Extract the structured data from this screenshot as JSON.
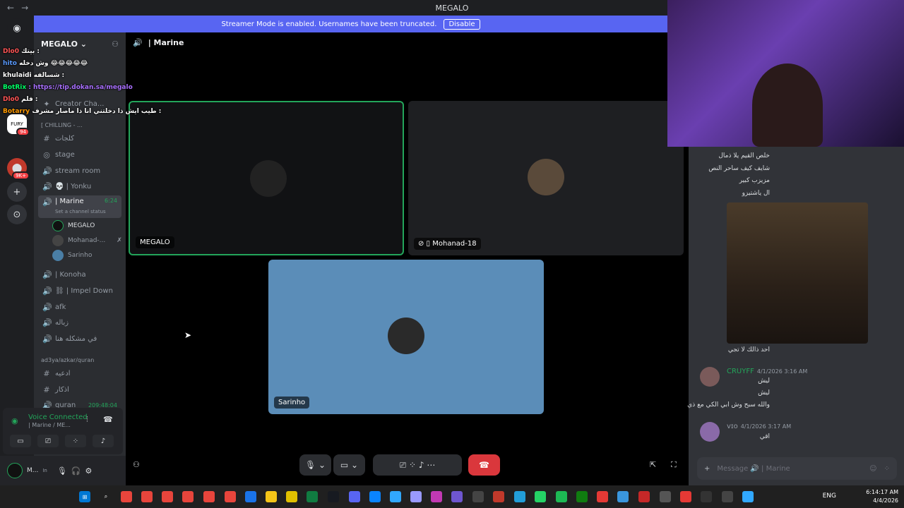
{
  "window": {
    "title": "MEGALO",
    "back": "←",
    "forward": "→"
  },
  "streamer_banner": {
    "text": "Streamer Mode is enabled. Usernames have been truncated.",
    "button": "Disable"
  },
  "guilds": [
    {
      "name": "discord-icon",
      "glyph": "◉",
      "badge": ""
    },
    {
      "name": "guild-fury",
      "glyph": "FURY",
      "badge": "94"
    },
    {
      "name": "guild-multi",
      "glyph": "⬤",
      "badge": "9K+"
    },
    {
      "name": "add-server",
      "glyph": "+",
      "badge": ""
    },
    {
      "name": "discover",
      "glyph": "⊙",
      "badge": ""
    }
  ],
  "server": {
    "name": "MEGALO ⌄"
  },
  "channels": {
    "creator": "Creator Cha...",
    "category_chilling": "[ CHILLING - ...",
    "items": [
      {
        "name": "كلجات",
        "icon": "#"
      },
      {
        "name": "stage",
        "icon": "◎"
      },
      {
        "name": "stream room",
        "icon": "🔊"
      },
      {
        "name": "💀 | Yonku",
        "icon": "🔊"
      },
      {
        "name": "| Marine",
        "icon": "🔊",
        "timer": "6:24",
        "status": "Set a channel status"
      },
      {
        "name": "| Konoha",
        "icon": "🔊"
      },
      {
        "name": "⛓ | Impel Down",
        "icon": "🔊"
      },
      {
        "name": "afk",
        "icon": "🔊"
      },
      {
        "name": "زباله",
        "icon": "🔊"
      },
      {
        "name": "في مشكله هنا",
        "icon": "🔊"
      }
    ],
    "voice_users": [
      "MEGALO",
      "Mohanad-...",
      "Sarinho"
    ],
    "category_quran": "ad3ya/azkar/quran",
    "quran_items": [
      {
        "name": "ادعيه",
        "icon": "#"
      },
      {
        "name": "اذكار",
        "icon": "#"
      },
      {
        "name": "quran",
        "icon": "🔊",
        "timer": "209:48:04"
      }
    ]
  },
  "voice_status": {
    "title": "Voice Connected",
    "sub": "| Marine / ME..."
  },
  "user": {
    "name": "M...",
    "status": "In"
  },
  "call": {
    "channel": "| Marine",
    "tiles": [
      {
        "name": "MEGALO"
      },
      {
        "name": "Mohanad-18"
      },
      {
        "name": "Sarinho"
      }
    ]
  },
  "overlay_chat": [
    {
      "user": "Dlo0",
      "text": "بيتك :",
      "color": "#ff5555"
    },
    {
      "user": "hito",
      "text": "وش دخله 😂😂😂😂😂",
      "color": "#5b9bff"
    },
    {
      "user": "khulaidi",
      "text": "شسالفه :",
      "color": "#ffffff"
    },
    {
      "user": "BotRix",
      "text": ": https://tip.dokan.sa/megalo",
      "color": "#a970ff"
    },
    {
      "user": "Dlo0",
      "text": "فلم :",
      "color": "#ff5555"
    },
    {
      "user": "Botarry",
      "text": "طيب ايش ذا دخلتني انا ذا ماصار مشرف :",
      "color": "#ff9900"
    }
  ],
  "chat": {
    "lines_top": [
      "خلص القيم يلا ذمال",
      "شايف كيف ساحر النص",
      "مزيزب كبير",
      "ال ياشتيزو"
    ],
    "gif_caption": "احد ذالك لا تجي",
    "messages": [
      {
        "author": "CRUYFF",
        "time": "4/1/2026 3:16 AM",
        "lines": [
          "ليش",
          "ليش",
          "والله سبح وش ابي الكي مع ذي"
        ]
      },
      {
        "author": "ᴠɪᴏ",
        "time": "4/1/2026 3:17 AM",
        "lines": [
          "اقي"
        ]
      }
    ],
    "placeholder": "Message 🔊 | Marine"
  },
  "taskbar": {
    "lang": "ENG",
    "time": "6:14:17 AM",
    "date": "4/4/2026"
  }
}
